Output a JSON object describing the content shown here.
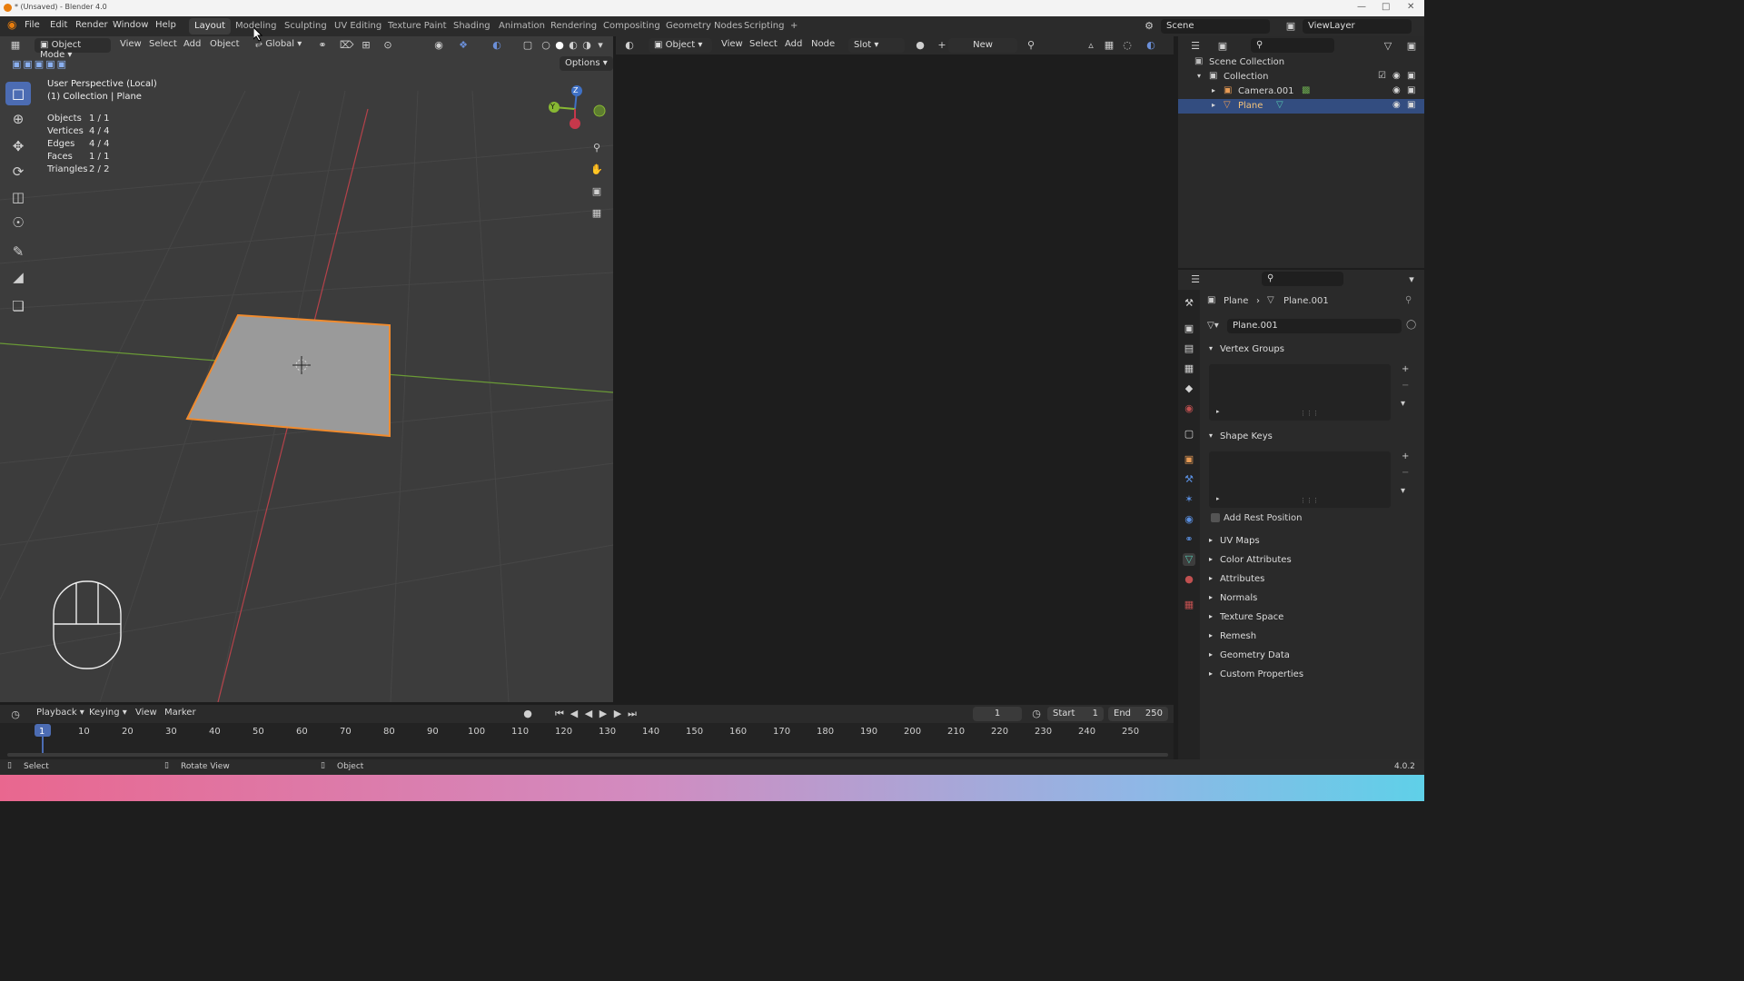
{
  "window": {
    "title": "* (Unsaved) - Blender 4.0"
  },
  "menubar": {
    "menus": [
      "File",
      "Edit",
      "Render",
      "Window",
      "Help"
    ],
    "workspaces": [
      "Layout",
      "Modeling",
      "Sculpting",
      "UV Editing",
      "Texture Paint",
      "Shading",
      "Animation",
      "Rendering",
      "Compositing",
      "Geometry Nodes",
      "Scripting"
    ],
    "active_workspace": "Layout",
    "add_tab": "+",
    "scene": "Scene",
    "view_layer": "ViewLayer"
  },
  "viewport": {
    "mode": "Object Mode",
    "menus": [
      "View",
      "Select",
      "Add",
      "Object"
    ],
    "orientation": "Global",
    "options": "Options",
    "perspective": "User Perspective (Local)",
    "collection_line": "(1) Collection | Plane",
    "stats": [
      {
        "label": "Objects",
        "value": "1 / 1"
      },
      {
        "label": "Vertices",
        "value": "4 / 4"
      },
      {
        "label": "Edges",
        "value": "4 / 4"
      },
      {
        "label": "Faces",
        "value": "1 / 1"
      },
      {
        "label": "Triangles",
        "value": "2 / 2"
      }
    ],
    "gizmo_axes": {
      "z": "Z",
      "y": "Y"
    }
  },
  "shader_editor": {
    "type": "Object",
    "menus": [
      "View",
      "Select",
      "Add",
      "Node"
    ],
    "slot": "Slot",
    "new_button": "New"
  },
  "outliner": {
    "root": "Scene Collection",
    "collection": "Collection",
    "items": [
      "Camera.001",
      "Plane"
    ],
    "selected": "Plane"
  },
  "properties": {
    "breadcrumb_object": "Plane",
    "breadcrumb_data": "Plane.001",
    "datablock_name": "Plane.001",
    "panels_open": [
      "Vertex Groups",
      "Shape Keys"
    ],
    "add_rest_position": "Add Rest Position",
    "panels_closed": [
      "UV Maps",
      "Color Attributes",
      "Attributes",
      "Normals",
      "Texture Space",
      "Remesh",
      "Geometry Data",
      "Custom Properties"
    ]
  },
  "timeline": {
    "menus": [
      "Playback",
      "Keying",
      "View",
      "Marker"
    ],
    "current_frame": "1",
    "start_label": "Start",
    "start_value": "1",
    "end_label": "End",
    "end_value": "250",
    "ticks": [
      "1",
      "10",
      "20",
      "30",
      "40",
      "50",
      "60",
      "70",
      "80",
      "90",
      "100",
      "110",
      "120",
      "130",
      "140",
      "150",
      "160",
      "170",
      "180",
      "190",
      "200",
      "210",
      "220",
      "230",
      "240",
      "250"
    ]
  },
  "statusbar": {
    "select": "Select",
    "rotate": "Rotate View",
    "object": "Object",
    "version": "4.0.2"
  },
  "colors": {
    "accent_blue": "#4c6cb3",
    "selection_orange": "#f08b2e",
    "axis_red": "#b5424a",
    "axis_green": "#6a9a36"
  }
}
